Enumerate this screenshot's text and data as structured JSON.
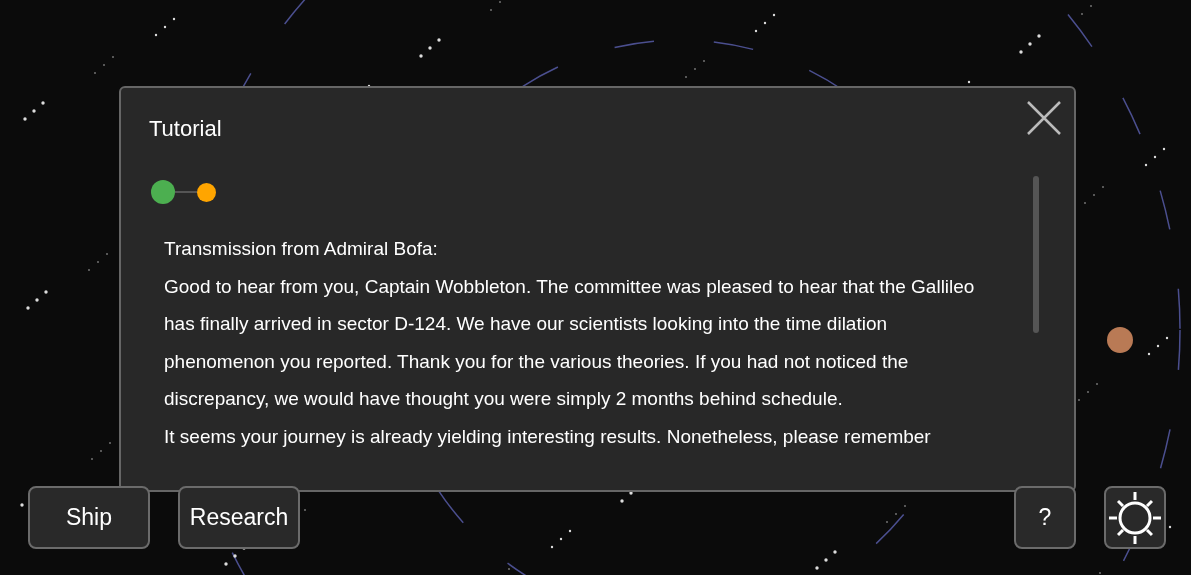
{
  "dialog": {
    "title": "Tutorial",
    "steps": [
      {
        "color": "#4caf50",
        "selected": true
      },
      {
        "color": "#ffa500",
        "selected": false
      }
    ],
    "paragraphs": [
      "Transmission from Admiral Bofa:",
      "Good to hear from you, Captain Wobbleton. The committee was pleased to hear that the Gallileo has finally arrived in sector D-124. We have our scientists looking into the time dilation phenomenon you reported. Thank you for the various theories. If you had not noticed the discrepancy, we would have thought you were simply 2 months behind schedule.",
      "It seems your journey is already yielding interesting results. Nonetheless, please remember"
    ]
  },
  "buttons": [
    {
      "kind": "text",
      "label": "Ship"
    },
    {
      "kind": "text",
      "label": "Research"
    },
    {
      "kind": "text",
      "label": "?"
    },
    {
      "kind": "sun"
    }
  ]
}
